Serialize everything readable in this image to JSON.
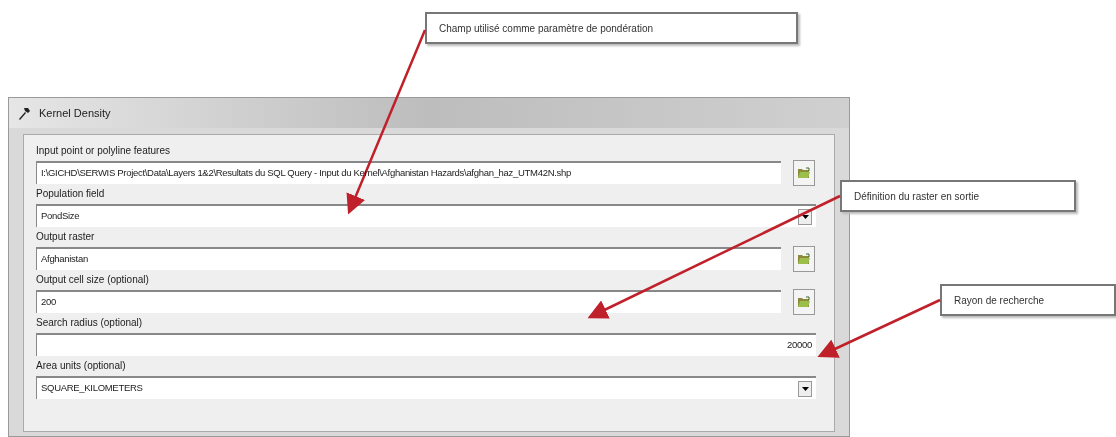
{
  "window": {
    "title": "Kernel Density"
  },
  "fields": [
    {
      "label": "Input point or polyline features",
      "kind": "browse",
      "value": "I:\\GICHD\\SERWIS Project\\Data\\Layers 1&2\\Resultats du SQL Query - Input du Kernel\\Afghanistan Hazards\\afghan_haz_UTM42N.shp"
    },
    {
      "label": "Population field",
      "kind": "combo",
      "value": "PondSize"
    },
    {
      "label": "Output raster",
      "kind": "browse",
      "value": "Afghanistan"
    },
    {
      "label": "Output cell size (optional)",
      "kind": "browse",
      "value": "200"
    },
    {
      "label": "Search radius (optional)",
      "kind": "number",
      "value": "20000"
    },
    {
      "label": "Area units (optional)",
      "kind": "combo",
      "value": "SQUARE_KILOMETERS"
    }
  ],
  "callouts": [
    {
      "text": "Champ utilisé comme paramètre de pondération"
    },
    {
      "text": "Définition du raster en sortie"
    },
    {
      "text": "Rayon de recherche"
    }
  ]
}
